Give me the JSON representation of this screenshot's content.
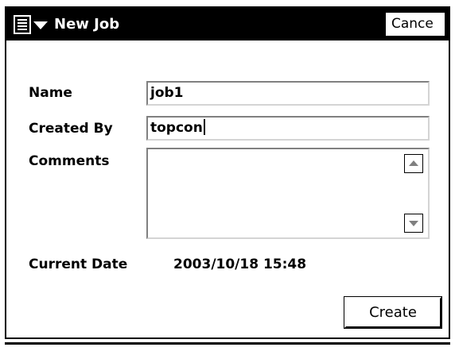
{
  "window": {
    "title": "New Job",
    "menu_icon": "document-menu-icon",
    "cancel_label": "Cance"
  },
  "form": {
    "name_label": "Name",
    "name_value": "job1",
    "created_by_label": "Created By",
    "created_by_value": "topcon",
    "comments_label": "Comments",
    "comments_value": "",
    "current_date_label": "Current Date",
    "current_date_value": "2003/10/18 15:48"
  },
  "actions": {
    "create_label": "Create"
  }
}
